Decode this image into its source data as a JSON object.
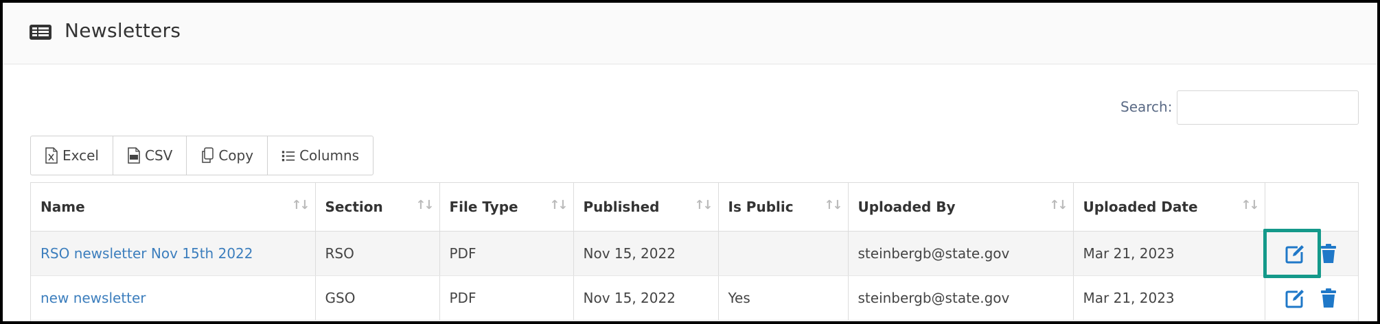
{
  "page": {
    "title": "Newsletters"
  },
  "search": {
    "label": "Search:",
    "value": ""
  },
  "toolbar": {
    "excel": "Excel",
    "csv": "CSV",
    "copy": "Copy",
    "columns": "Columns"
  },
  "table": {
    "columns": [
      "Name",
      "Section",
      "File Type",
      "Published",
      "Is Public",
      "Uploaded By",
      "Uploaded Date",
      ""
    ],
    "rows": [
      {
        "name": "RSO newsletter Nov 15th 2022",
        "section": "RSO",
        "file_type": "PDF",
        "published": "Nov 15, 2022",
        "is_public": "",
        "uploaded_by": "steinbergb@state.gov",
        "uploaded_date": "Mar 21, 2023"
      },
      {
        "name": "new newsletter",
        "section": "GSO",
        "file_type": "PDF",
        "published": "Nov 15, 2022",
        "is_public": "Yes",
        "uploaded_by": "steinbergb@state.gov",
        "uploaded_date": "Mar 21, 2023"
      }
    ]
  },
  "colors": {
    "accent": "#3c7ebd",
    "highlight": "#14998a",
    "action_icon": "#1f78c8"
  },
  "icons": {
    "header": "newspaper-icon",
    "excel": "excel-file-icon",
    "csv": "csv-file-icon",
    "copy": "copy-icon",
    "columns": "list-icon",
    "sort": "sort-icon",
    "edit": "edit-icon",
    "delete": "trash-icon"
  }
}
